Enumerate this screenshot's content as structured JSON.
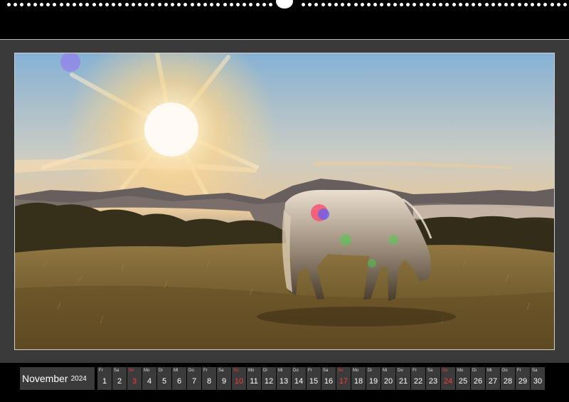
{
  "calendar": {
    "month": "November",
    "year": "2024",
    "days": [
      {
        "wd": "Fr",
        "n": "1",
        "sun": false
      },
      {
        "wd": "Sa",
        "n": "2",
        "sun": false
      },
      {
        "wd": "So",
        "n": "3",
        "sun": true
      },
      {
        "wd": "Mo",
        "n": "4",
        "sun": false
      },
      {
        "wd": "Di",
        "n": "5",
        "sun": false
      },
      {
        "wd": "Mi",
        "n": "6",
        "sun": false
      },
      {
        "wd": "Do",
        "n": "7",
        "sun": false
      },
      {
        "wd": "Fr",
        "n": "8",
        "sun": false
      },
      {
        "wd": "Sa",
        "n": "9",
        "sun": false
      },
      {
        "wd": "So",
        "n": "10",
        "sun": true
      },
      {
        "wd": "Mo",
        "n": "11",
        "sun": false
      },
      {
        "wd": "Di",
        "n": "12",
        "sun": false
      },
      {
        "wd": "Mi",
        "n": "13",
        "sun": false
      },
      {
        "wd": "Do",
        "n": "14",
        "sun": false
      },
      {
        "wd": "Fr",
        "n": "15",
        "sun": false
      },
      {
        "wd": "Sa",
        "n": "16",
        "sun": false
      },
      {
        "wd": "So",
        "n": "17",
        "sun": true
      },
      {
        "wd": "Mo",
        "n": "18",
        "sun": false
      },
      {
        "wd": "Di",
        "n": "19",
        "sun": false
      },
      {
        "wd": "Mi",
        "n": "20",
        "sun": false
      },
      {
        "wd": "Do",
        "n": "21",
        "sun": false
      },
      {
        "wd": "Fr",
        "n": "22",
        "sun": false
      },
      {
        "wd": "Sa",
        "n": "23",
        "sun": false
      },
      {
        "wd": "So",
        "n": "24",
        "sun": true
      },
      {
        "wd": "Mo",
        "n": "25",
        "sun": false
      },
      {
        "wd": "Di",
        "n": "26",
        "sun": false
      },
      {
        "wd": "Mi",
        "n": "27",
        "sun": false
      },
      {
        "wd": "Do",
        "n": "28",
        "sun": false
      },
      {
        "wd": "Fr",
        "n": "29",
        "sun": false
      },
      {
        "wd": "Sa",
        "n": "30",
        "sun": false
      }
    ]
  },
  "colors": {
    "sunday": "#ff3b3b",
    "cell": "#3b3b3b",
    "page": "#3a3a3a"
  }
}
